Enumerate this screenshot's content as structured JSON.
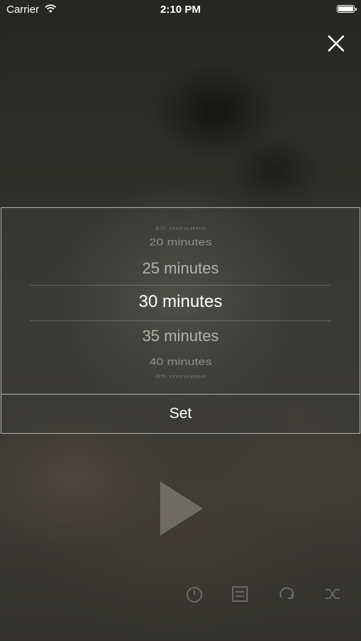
{
  "status_bar": {
    "carrier": "Carrier",
    "time": "2:10 PM"
  },
  "icons": {
    "close": "close-icon",
    "wifi": "wifi-icon",
    "battery": "battery-icon",
    "play": "play-icon",
    "toolbar": [
      "timer-icon",
      "playlist-icon",
      "repeat-icon",
      "shuffle-icon"
    ]
  },
  "picker": {
    "options": [
      "15 minutes",
      "20 minutes",
      "25 minutes",
      "30 minutes",
      "35 minutes",
      "40 minutes",
      "45 minutes"
    ],
    "selected": "30 minutes",
    "set_label": "Set"
  },
  "colors": {
    "text": "#ffffff",
    "panel_border": "#dcdcd7"
  }
}
